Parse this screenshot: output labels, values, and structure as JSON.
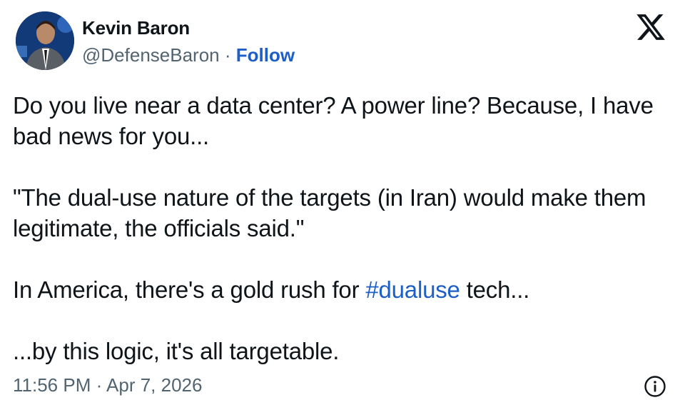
{
  "author": {
    "name": "Kevin Baron",
    "handle": "@DefenseBaron",
    "separator": " · ",
    "follow_label": "Follow"
  },
  "tweet": {
    "para1": "Do you live near a data center? A power line? Because, I have bad news for you...",
    "para2": "\"The dual-use nature of the targets (in Iran) would make them legitimate, the officials said.\"",
    "para3_before": "In America, there's a gold rush for ",
    "para3_hashtag": "#dualuse",
    "para3_after": " tech...",
    "para4": "...by this logic, it's all targetable."
  },
  "footer": {
    "timestamp": "11:56 PM · Apr 7, 2026"
  },
  "icons": {
    "platform": "x-logo-icon",
    "info": "info-icon"
  },
  "colors": {
    "text": "#0f1419",
    "muted": "#536471",
    "link": "#1d5fc7"
  }
}
